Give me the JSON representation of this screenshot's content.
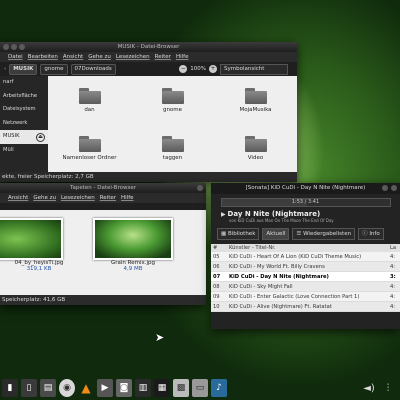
{
  "window1": {
    "title": "MUSIK - Datei-Browser",
    "menu": [
      "Datei",
      "Bearbeiten",
      "Ansicht",
      "Gehe zu",
      "Lesezeichen",
      "Reiter",
      "Hilfe"
    ],
    "breadcrumbs": [
      "MUSIK",
      "gnome",
      "07Downloads"
    ],
    "zoom": "100%",
    "view_mode": "Symbolansicht",
    "sidebar": [
      {
        "label": "narf"
      },
      {
        "label": "Arbeitsfläche"
      },
      {
        "label": "Dateisystem"
      },
      {
        "label": "Netzwerk"
      },
      {
        "label": "MUSIK",
        "selected": true
      },
      {
        "label": "Müll"
      }
    ],
    "folders": [
      "dan",
      "gnome",
      "MojaMusika",
      "Namenloser Ordner",
      "taggen",
      "Video"
    ],
    "status": "ekte, freier Speicherplatz: 2,7 GB"
  },
  "window2": {
    "title": "Tapeten - Datei-Browser",
    "menu": [
      "Ansicht",
      "Gehe zu",
      "Lesezeichen",
      "Reiter",
      "Hilfe"
    ],
    "images": [
      {
        "name": "04_by_heyisTi.jpg",
        "size": "319,1 KB"
      },
      {
        "name": "Grain Remix.jpg",
        "size": "4,9 MB"
      }
    ],
    "status": "Speicherplatz: 41,6 GB"
  },
  "player": {
    "title": "[Sonata] KiD CuDi - Day N Nite  (Nightmare)",
    "time": "1:53 / 3:41",
    "progress": 0.51,
    "track_title": "Day N Nite  (Nightmare)",
    "track_subtitle": "von KiD CuDi aus Man On The Moon The End Of Day",
    "tabs": [
      "Bibliothek",
      "Aktuell",
      "Wiedergabelisten",
      "Info"
    ],
    "columns": [
      "#",
      "Künstler - Titel-Nr.",
      "La"
    ],
    "rows": [
      {
        "num": "05",
        "title": "KiD CuDi - Heart Of A Lion (KiD CuDi Theme Music)",
        "len": "4:"
      },
      {
        "num": "06",
        "title": "KiD CuDi - My World Ft. Billy Cravens",
        "len": "4:"
      },
      {
        "num": "07",
        "title": "KiD CuDi - Day N Nite  (Nightmare)",
        "len": "3:",
        "playing": true
      },
      {
        "num": "08",
        "title": "KiD CuDi - Sky Might Fall",
        "len": "4:"
      },
      {
        "num": "09",
        "title": "KiD CuDi - Enter Galactic (Love Connection Part 1)",
        "len": "4:"
      },
      {
        "num": "10",
        "title": "KiD CuDi - Alive (Nightmare) Ft. Ratatat",
        "len": "4:"
      }
    ]
  },
  "dock": [
    "folder-icon",
    "files-icon",
    "disc-icon",
    "vlc-icon",
    "video-icon",
    "camera-icon",
    "film-icon",
    "board-icon",
    "calculator-icon",
    "monitor-icon",
    "music-icon"
  ],
  "tray": [
    "volume-icon",
    "network-icon"
  ]
}
